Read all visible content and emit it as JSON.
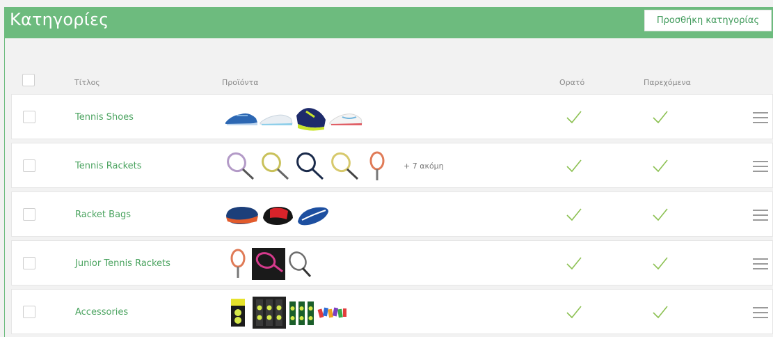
{
  "header": {
    "title": "Κατηγορίες",
    "add_button": "Προσθήκη κατηγορίας"
  },
  "columns": {
    "title": "Τίτλος",
    "products": "Προϊόντα",
    "visible": "Ορατό",
    "provided": "Παρεχόμενα"
  },
  "rows": [
    {
      "title": "Tennis Shoes",
      "more": "",
      "visible": true,
      "provided": true
    },
    {
      "title": "Tennis Rackets",
      "more": "+ 7 ακόμη",
      "visible": true,
      "provided": true
    },
    {
      "title": "Racket Bags",
      "more": "",
      "visible": true,
      "provided": true
    },
    {
      "title": "Junior Tennis Rackets",
      "more": "",
      "visible": true,
      "provided": true
    },
    {
      "title": "Accessories",
      "more": "",
      "visible": true,
      "provided": true
    }
  ],
  "colors": {
    "accent": "#6dbb7e",
    "link": "#4aa35f",
    "check": "#8cc152"
  }
}
